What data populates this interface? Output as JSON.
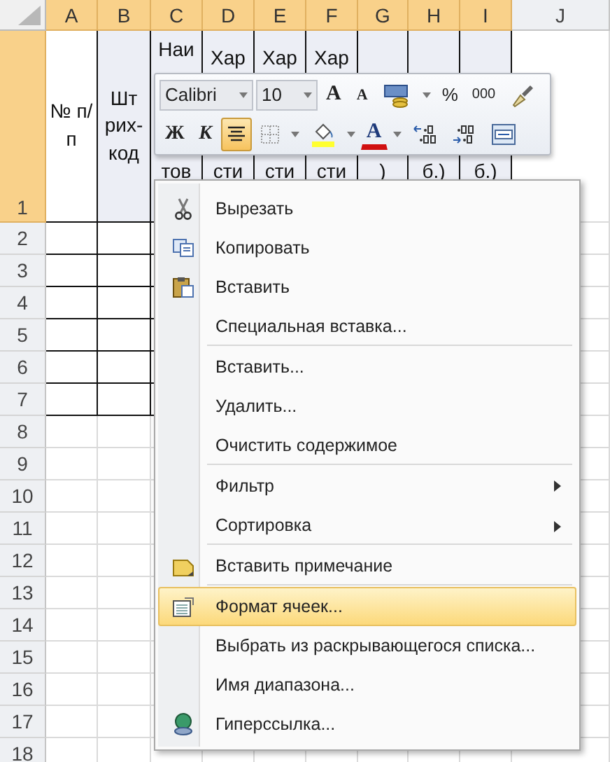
{
  "columns": [
    {
      "label": "A",
      "selected": true
    },
    {
      "label": "B",
      "selected": true
    },
    {
      "label": "C",
      "selected": true
    },
    {
      "label": "D",
      "selected": true
    },
    {
      "label": "E",
      "selected": true
    },
    {
      "label": "F",
      "selected": true
    },
    {
      "label": "G",
      "selected": true
    },
    {
      "label": "H",
      "selected": true
    },
    {
      "label": "I",
      "selected": true
    },
    {
      "label": "J",
      "selected": false
    }
  ],
  "rows": [
    {
      "label": "1",
      "selected": true
    },
    {
      "label": "2",
      "selected": false
    },
    {
      "label": "3",
      "selected": false
    },
    {
      "label": "4",
      "selected": false
    },
    {
      "label": "5",
      "selected": false
    },
    {
      "label": "6",
      "selected": false
    },
    {
      "label": "7",
      "selected": false
    },
    {
      "label": "8",
      "selected": false
    },
    {
      "label": "9",
      "selected": false
    },
    {
      "label": "10",
      "selected": false
    },
    {
      "label": "11",
      "selected": false
    },
    {
      "label": "12",
      "selected": false
    },
    {
      "label": "13",
      "selected": false
    },
    {
      "label": "14",
      "selected": false
    },
    {
      "label": "15",
      "selected": false
    },
    {
      "label": "16",
      "selected": false
    },
    {
      "label": "17",
      "selected": false
    },
    {
      "label": "18",
      "selected": false
    }
  ],
  "header_cells": [
    {
      "kind": "whole",
      "text": "№ п/п"
    },
    {
      "kind": "whole",
      "text": "Шт рих- код"
    },
    {
      "kind": "split",
      "top": "Наи",
      "bottom": "тов"
    },
    {
      "kind": "split",
      "top": "Хар",
      "bottom": "сти"
    },
    {
      "kind": "split",
      "top": "Хар",
      "bottom": "сти"
    },
    {
      "kind": "split",
      "top": "Хар",
      "bottom": "сти"
    },
    {
      "kind": "split",
      "bottom": ")"
    },
    {
      "kind": "split",
      "bottom": "б.)"
    },
    {
      "kind": "split",
      "bottom": "б.)"
    }
  ],
  "mini_toolbar": {
    "row_1": [
      {
        "kind": "font-field",
        "text": "Calibri"
      },
      {
        "kind": "size-field",
        "text": "10"
      },
      {
        "kind": "grow-font",
        "text": "A"
      },
      {
        "kind": "shrink-font",
        "text": "A"
      },
      {
        "kind": "currency"
      },
      {
        "kind": "dropdown"
      },
      {
        "kind": "percent",
        "text": "%"
      },
      {
        "kind": "thousands",
        "text": "000"
      },
      {
        "kind": "format-painter"
      }
    ],
    "row_2": [
      {
        "kind": "bold",
        "text": "Ж",
        "pressed": false
      },
      {
        "kind": "italic",
        "text": "К",
        "pressed": false
      },
      {
        "kind": "align-center",
        "pressed": true
      },
      {
        "kind": "borders",
        "pressed": false
      },
      {
        "kind": "dropdown",
        "pressed": false
      },
      {
        "kind": "fill-color",
        "pressed": false
      },
      {
        "kind": "dropdown",
        "pressed": false
      },
      {
        "kind": "font-color",
        "text": "A",
        "pressed": false
      },
      {
        "kind": "dropdown",
        "pressed": false
      },
      {
        "kind": "increase-decimal",
        "pressed": false
      },
      {
        "kind": "decrease-decimal",
        "pressed": false
      },
      {
        "kind": "merge",
        "pressed": false
      }
    ]
  },
  "context_menu": [
    {
      "label": "Вырезать",
      "kind": "cut",
      "submenu": false,
      "separator_after": false,
      "selected": false
    },
    {
      "label": "Копировать",
      "kind": "copy",
      "submenu": false,
      "separator_after": false,
      "selected": false
    },
    {
      "label": "Вставить",
      "kind": "paste",
      "submenu": false,
      "separator_after": false,
      "selected": false
    },
    {
      "label": "Специальная вставка...",
      "submenu": false,
      "separator_after": true,
      "selected": false
    },
    {
      "label": "Вставить...",
      "submenu": false,
      "separator_after": false,
      "selected": false
    },
    {
      "label": "Удалить...",
      "submenu": false,
      "separator_after": false,
      "selected": false
    },
    {
      "label": "Очистить содержимое",
      "submenu": false,
      "separator_after": true,
      "selected": false
    },
    {
      "label": "Фильтр",
      "submenu": true,
      "separator_after": false,
      "selected": false
    },
    {
      "label": "Сортировка",
      "submenu": true,
      "separator_after": true,
      "selected": false
    },
    {
      "label": "Вставить примечание",
      "kind": "comment",
      "submenu": false,
      "separator_after": true,
      "selected": false
    },
    {
      "label": "Формат ячеек...",
      "kind": "format",
      "submenu": false,
      "separator_after": false,
      "selected": true
    },
    {
      "label": "Выбрать из раскрывающегося списка...",
      "submenu": false,
      "separator_after": false,
      "selected": false
    },
    {
      "label": "Имя диапазона...",
      "submenu": false,
      "separator_after": false,
      "selected": false
    },
    {
      "label": "Гиперссылка...",
      "kind": "link",
      "submenu": false,
      "separator_after": false,
      "selected": false
    }
  ]
}
